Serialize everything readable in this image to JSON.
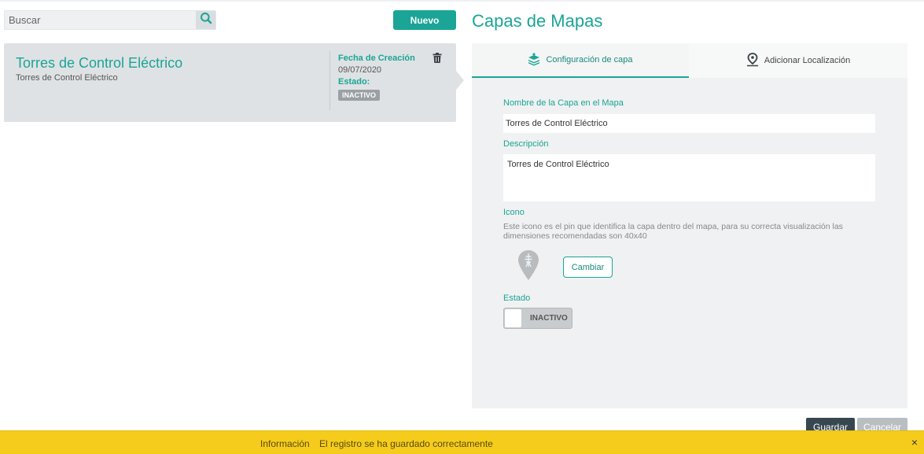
{
  "search": {
    "placeholder": "Buscar",
    "icon": "search-icon"
  },
  "toolbar": {
    "new_label": "Nuevo"
  },
  "list": {
    "items": [
      {
        "title": "Torres de Control Eléctrico",
        "subtitle": "Torres de Control Eléctrico",
        "created_label": "Fecha de Creación",
        "created_value": "09/07/2020",
        "status_label": "Estado:",
        "status_badge": "INACTIVO",
        "delete_icon": "trash-icon"
      }
    ]
  },
  "panel": {
    "title": "Capas de Mapas",
    "tabs": [
      {
        "label": "Configuración de capa",
        "icon": "layers-icon",
        "active": true
      },
      {
        "label": "Adicionar Localización",
        "icon": "map-pin-icon",
        "active": false
      }
    ],
    "form": {
      "name_label": "Nombre de la Capa en el Mapa",
      "name_value": "Torres de Control Eléctrico",
      "description_label": "Descripción",
      "description_value": "Torres de Control Eléctrico",
      "icon_label": "Icono",
      "icon_help": "Este icono es el pin que identifica la capa dentro del mapa, para su correcta visualización las dimensiones recomendadas son 40x40",
      "change_button": "Cambiar",
      "status_label": "Estado",
      "status_toggle": "INACTIVO"
    }
  },
  "footer": {
    "save_label": "Guardar",
    "cancel_label": "Cancelar"
  },
  "notification": {
    "title": "Información",
    "message": "El registro se ha guardado correctamente",
    "close": "×"
  },
  "colors": {
    "accent": "#1aa596",
    "notification": "#f5cc1c",
    "dark_button": "#37474f"
  }
}
